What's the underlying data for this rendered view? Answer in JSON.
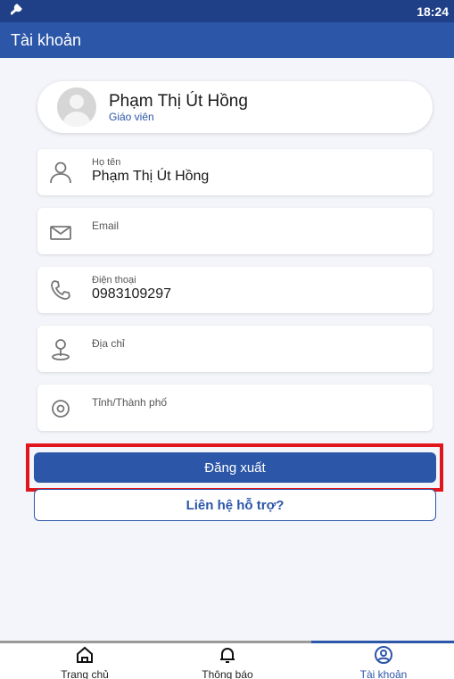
{
  "status_bar": {
    "time": "18:24",
    "tool_icon": "wrench-icon"
  },
  "app_bar": {
    "title": "Tài khoản"
  },
  "profile": {
    "name": "Phạm Thị Út Hồng",
    "role": "Giáo viên",
    "avatar_icon": "avatar-placeholder-icon"
  },
  "fields": {
    "fullname": {
      "label": "Họ tên",
      "value": "Phạm Thị Út Hồng",
      "icon": "person-icon"
    },
    "email": {
      "label": "Email",
      "value": "",
      "icon": "mail-icon"
    },
    "phone": {
      "label": "Điện thoại",
      "value": "0983109297",
      "icon": "phone-icon"
    },
    "address": {
      "label": "Địa chỉ",
      "value": "",
      "icon": "map-pin-icon"
    },
    "city": {
      "label": "Tỉnh/Thành phố",
      "value": "",
      "icon": "location-target-icon"
    }
  },
  "buttons": {
    "logout": "Đăng xuất",
    "support": "Liên hệ hỗ trợ?"
  },
  "tabs": [
    {
      "label": "Trang chủ",
      "icon": "home-icon",
      "active": false
    },
    {
      "label": "Thông báo",
      "icon": "bell-icon",
      "active": false
    },
    {
      "label": "Tài khoản",
      "icon": "account-icon",
      "active": true
    }
  ],
  "colors": {
    "primary": "#2c56a8",
    "status_bar": "#1f3f86",
    "highlight": "#e0161c",
    "background": "#f3f5fa"
  }
}
